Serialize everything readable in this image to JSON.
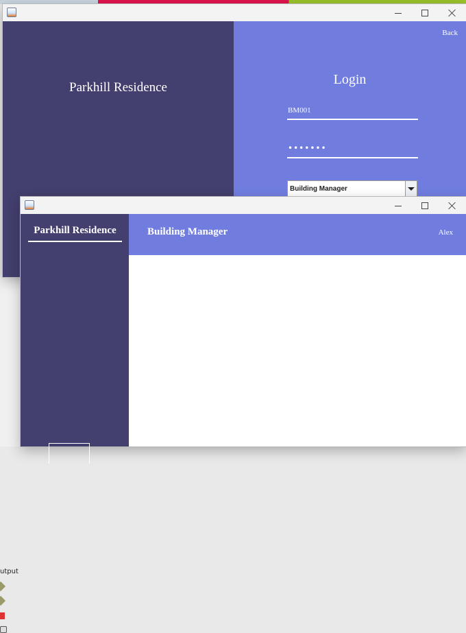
{
  "colors": {
    "sidebar": "#433f6e",
    "accent": "#707ddf",
    "text_on_dark": "#ffffff"
  },
  "login_window": {
    "brand": "Parkhill Residence",
    "back_label": "Back",
    "title": "Login",
    "username_value": "BM001",
    "password_value": "•••••••",
    "role_selected": "Building Manager",
    "icons": {
      "app": "java-app-icon",
      "minimize": "minimize-icon",
      "maximize": "maximize-icon",
      "close": "close-icon",
      "dropdown": "chevron-down-icon"
    }
  },
  "dashboard_window": {
    "brand": "Parkhill Residence",
    "title": "Building Manager",
    "user_name": "Alex",
    "icons": {
      "app": "java-app-icon",
      "minimize": "minimize-icon",
      "maximize": "maximize-icon",
      "close": "close-icon"
    }
  },
  "ide_panel": {
    "output_label": "utput"
  }
}
